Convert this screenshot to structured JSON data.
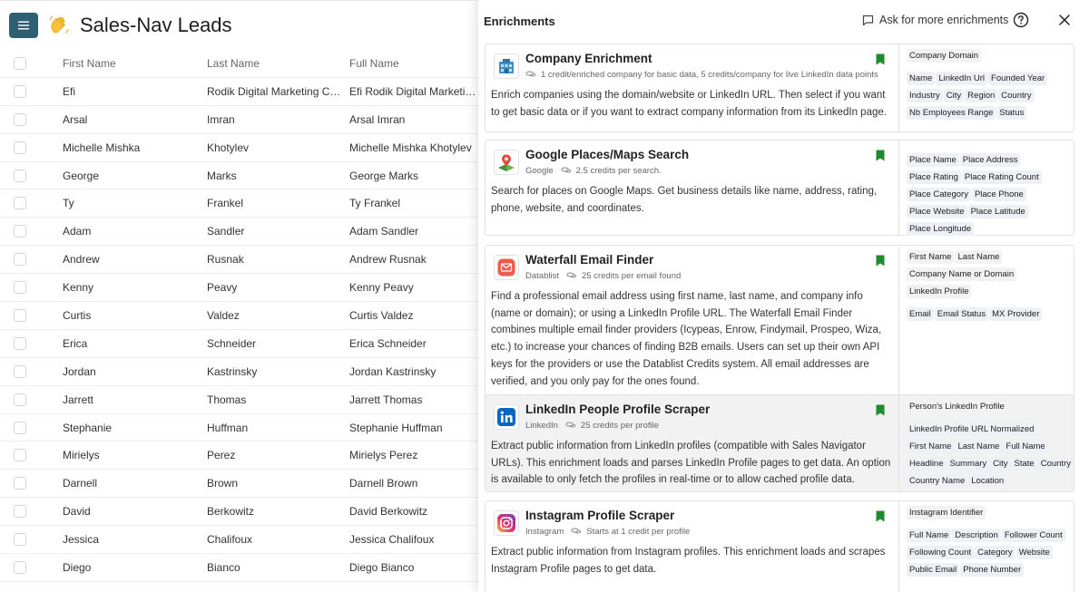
{
  "app": {
    "title": "Sales-Nav Leads",
    "columns": [
      "First Name",
      "Last Name",
      "Full Name"
    ],
    "rows": [
      [
        "Efi",
        "Rodik Digital Marketing Con...",
        "Efi Rodik Digital Marketing ..."
      ],
      [
        "Arsal",
        "Imran",
        "Arsal Imran"
      ],
      [
        "Michelle Mishka",
        "Khotylev",
        "Michelle Mishka Khotylev"
      ],
      [
        "George",
        "Marks",
        "George Marks"
      ],
      [
        "Ty",
        "Frankel",
        "Ty Frankel"
      ],
      [
        "Adam",
        "Sandler",
        "Adam Sandler"
      ],
      [
        "Andrew",
        "Rusnak",
        "Andrew Rusnak"
      ],
      [
        "Kenny",
        "Peavy",
        "Kenny Peavy"
      ],
      [
        "Curtis",
        "Valdez",
        "Curtis Valdez"
      ],
      [
        "Erica",
        "Schneider",
        "Erica Schneider"
      ],
      [
        "Jordan",
        "Kastrinsky",
        "Jordan Kastrinsky"
      ],
      [
        "Jarrett",
        "Thomas",
        "Jarrett Thomas"
      ],
      [
        "Stephanie",
        "Huffman",
        "Stephanie Huffman"
      ],
      [
        "Mirielys",
        "Perez",
        "Mirielys Perez"
      ],
      [
        "Darnell",
        "Brown",
        "Darnell Brown"
      ],
      [
        "David",
        "Berkowitz",
        "David Berkowitz"
      ],
      [
        "Jessica",
        "Chalifoux",
        "Jessica Chalifoux"
      ],
      [
        "Diego",
        "Bianco",
        "Diego Bianco"
      ]
    ]
  },
  "panel": {
    "title": "Enrichments",
    "ask_label": "Ask for more enrichments",
    "icons": {
      "menu": "menu-icon",
      "wave": "waving-hand-icon",
      "chat": "chat-bubble-icon",
      "help": "help-circle-icon",
      "close": "close-icon",
      "coins": "coins-icon",
      "bookmark": "bookmark-icon"
    },
    "accent": "#2f5f73",
    "bookmark_color": "#1f8a2e",
    "cards": [
      {
        "title": "Company Enrichment",
        "provider": "",
        "credits": "1 credit/enriched company for basic data, 5 credits/company for live LinkedIn data points",
        "description": "Enrich companies using the domain/website or LinkedIn URL. Then select if you want to get basic data or if you want to extract company information from its LinkedIn page.",
        "logo": "building-icon",
        "inputs": [
          "Company Domain"
        ],
        "outputs": [
          "Name",
          "LinkedIn Url",
          "Founded Year",
          "Industry",
          "City",
          "Region",
          "Country",
          "Nb Employees Range",
          "Status"
        ]
      },
      {
        "title": "Google Places/Maps Search",
        "provider": "Google",
        "credits": "2.5 credits per search.",
        "description": "Search for places on Google Maps. Get business details like name, address, rating, phone, website, and coordinates.",
        "logo": "google-maps-icon",
        "inputs": [],
        "outputs": [
          "Place Name",
          "Place Address",
          "Place Rating",
          "Place Rating Count",
          "Place Category",
          "Place Phone",
          "Place Website",
          "Place Latitude",
          "Place Longitude"
        ]
      },
      {
        "title": "Waterfall Email Finder",
        "provider": "Datablist",
        "credits": "25 credits per email found",
        "description": "Find a professional email address using first name, last name, and company info (name or domain); or using a LinkedIn Profile URL. The Waterfall Email Finder combines multiple email finder providers (Icypeas, Enrow, Findymail, Prospeo, Wiza, etc.) to increase your chances of finding B2B emails. Users can set up their own API keys for the providers or use the Datablist Credits system. All email addresses are verified, and you only pay for the ones found.",
        "logo": "email-icon",
        "inputs": [
          "First Name",
          "Last Name",
          "Company Name or Domain",
          "LinkedIn Profile"
        ],
        "outputs": [
          "Email",
          "Email Status",
          "MX Provider"
        ]
      },
      {
        "title": "LinkedIn People Profile Scraper",
        "provider": "LinkedIn",
        "credits": "25 credits per profile",
        "description": "Extract public information from LinkedIn profiles (compatible with Sales Navigator URLs). This enrichment loads and parses LinkedIn Profile pages to get data. An option is available to only fetch the profiles in real-time or to allow cached profile data.",
        "logo": "linkedin-icon",
        "inputs": [
          "Person's LinkedIn Profile"
        ],
        "outputs": [
          "LinkedIn Profile URL Normalized",
          "First Name",
          "Last Name",
          "Full Name",
          "Headline",
          "Summary",
          "City",
          "State",
          "Country",
          "Country Name",
          "Location"
        ]
      },
      {
        "title": "Instagram Profile Scraper",
        "provider": "Instagram",
        "credits": "Starts at 1 credit per profile",
        "description": "Extract public information from Instagram profiles. This enrichment loads and scrapes Instagram Profile pages to get data.",
        "logo": "instagram-icon",
        "inputs": [
          "Instagram Identifier"
        ],
        "outputs": [
          "Full Name",
          "Description",
          "Follower Count",
          "Following Count",
          "Category",
          "Website",
          "Public Email",
          "Phone Number"
        ]
      }
    ]
  }
}
